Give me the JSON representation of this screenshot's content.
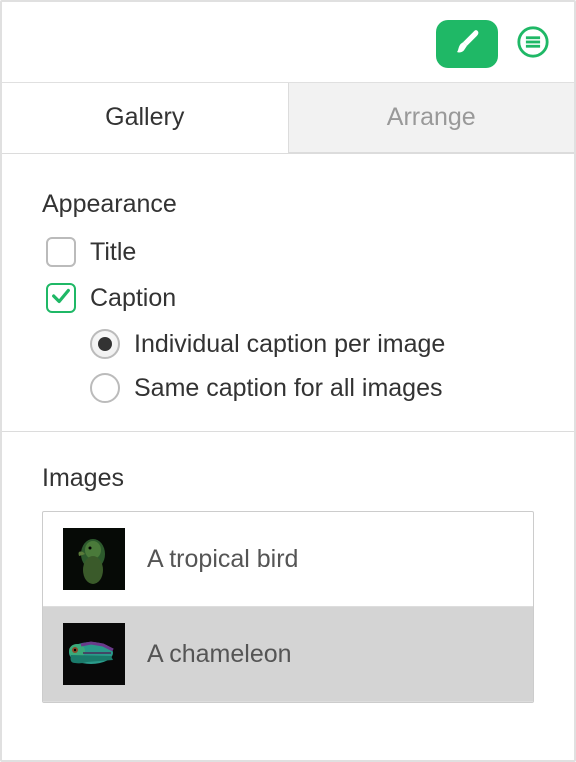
{
  "accent_color": "#1fb866",
  "toolbar": {
    "format_icon": "brush",
    "menu_icon": "menu"
  },
  "tabs": {
    "gallery": {
      "label": "Gallery",
      "active": true
    },
    "arrange": {
      "label": "Arrange",
      "active": false
    }
  },
  "appearance": {
    "heading": "Appearance",
    "title_checkbox": {
      "label": "Title",
      "checked": false
    },
    "caption_checkbox": {
      "label": "Caption",
      "checked": true
    },
    "caption_mode": {
      "individual": {
        "label": "Individual caption per image",
        "selected": true
      },
      "same": {
        "label": "Same caption for all images",
        "selected": false
      }
    }
  },
  "images": {
    "heading": "Images",
    "items": [
      {
        "caption": "A tropical bird",
        "selected": false,
        "thumb": "bird"
      },
      {
        "caption": "A chameleon",
        "selected": true,
        "thumb": "chameleon"
      }
    ]
  }
}
